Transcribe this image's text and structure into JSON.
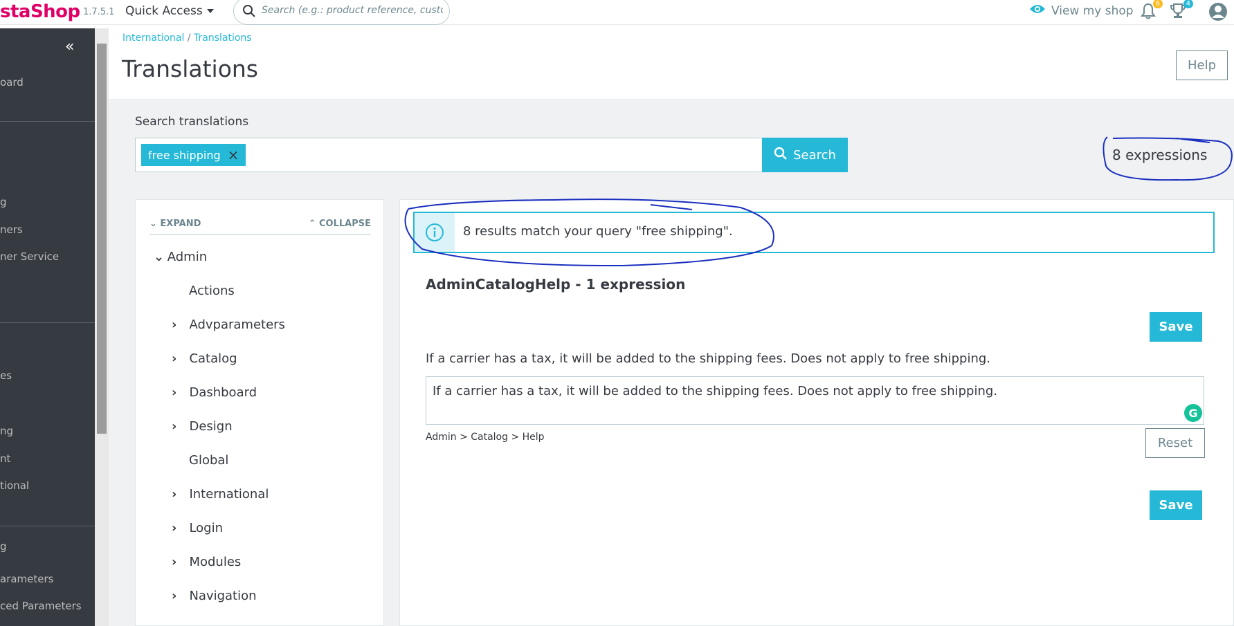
{
  "header": {
    "logo": "staShop",
    "version": "1.7.5.1",
    "quick_access": "Quick Access",
    "search_placeholder": "Search (e.g.: product reference, custome",
    "view_shop": "View my shop",
    "notifications_count": "6",
    "trophy_count": "4"
  },
  "sidebar": {
    "items": [
      "oard",
      "g",
      "ners",
      "ner Service",
      "es",
      "ng",
      "nt",
      "tional",
      "g",
      "arameters",
      "ced Parameters"
    ]
  },
  "breadcrumb": {
    "parent": "International",
    "separator": " / ",
    "current": "Translations"
  },
  "page": {
    "title": "Translations",
    "help": "Help"
  },
  "search": {
    "label": "Search translations",
    "tag": "free shipping",
    "button": "Search",
    "count": "8 expressions"
  },
  "tree": {
    "expand": "EXPAND",
    "collapse": "COLLAPSE",
    "root": "Admin",
    "children": [
      "Actions",
      "Advparameters",
      "Catalog",
      "Dashboard",
      "Design",
      "Global",
      "International",
      "Login",
      "Modules",
      "Navigation"
    ]
  },
  "results": {
    "alert": "8 results match your query \"free shipping\".",
    "domain_title": "AdminCatalogHelp - 1 expression",
    "save": "Save",
    "original": "If a carrier has a tax, it will be added to the shipping fees. Does not apply to free shipping.",
    "translation": "If a carrier has a tax, it will be added to the shipping fees. Does not apply to free shipping.",
    "path": "Admin > Catalog > Help",
    "reset": "Reset",
    "grammarly": "G"
  },
  "colors": {
    "accent": "#25b9d7",
    "brand": "#df0067",
    "sidebar": "#363a41",
    "annotation": "#1a2fbf"
  }
}
